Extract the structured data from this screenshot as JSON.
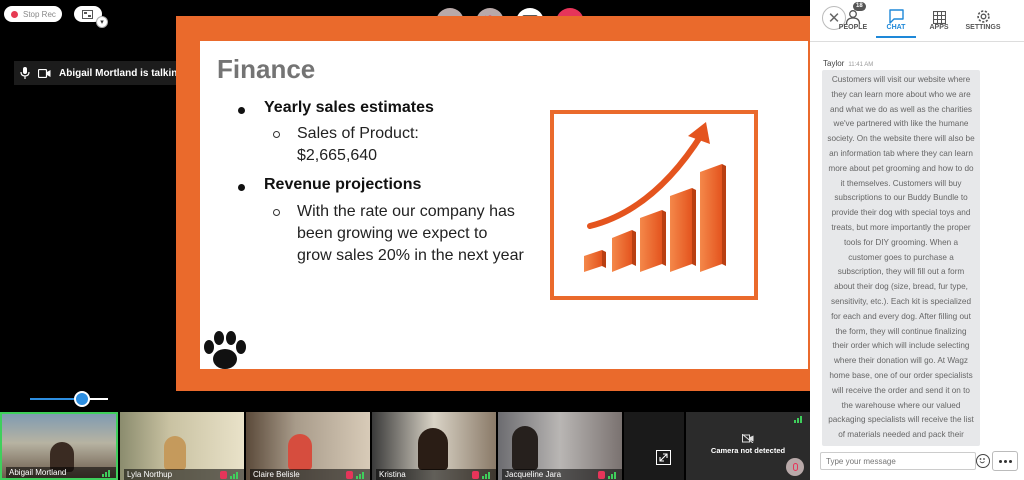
{
  "header": {
    "stop_rec_label": "Stop Rec",
    "talking_text": "Abigail Mortland is talking"
  },
  "slide": {
    "title": "Finance",
    "bullet1": "Yearly sales estimates",
    "sub1_line1": "Sales of Product:",
    "sub1_line2": "$2,665,640",
    "bullet2": "Revenue projections",
    "sub2_line1": "With the rate our company has",
    "sub2_line2": "been growing we expect to",
    "sub2_line3": "grow sales 20% in the next year"
  },
  "volume": {
    "level": 0.67
  },
  "filmstrip": {
    "participants": [
      {
        "name": "Abigail Mortland"
      },
      {
        "name": "Lyla Northup"
      },
      {
        "name": "Claire Belisle"
      },
      {
        "name": "Kristina"
      },
      {
        "name": "Jacqueline Jara"
      }
    ],
    "camera_status": "Camera not detected"
  },
  "panel": {
    "tabs": [
      {
        "label": "PEOPLE",
        "badge": "18"
      },
      {
        "label": "CHAT"
      },
      {
        "label": "APPS"
      },
      {
        "label": "SETTINGS"
      }
    ],
    "chat": {
      "author": "Taylor",
      "time": "11:41 AM",
      "message": "Customers will visit our website where they can learn more about who we are and what we do as well as the charities we've partnered with like the humane society. On the website there will also be an information tab where they can learn more about pet grooming and how to do it themselves. Customers will buy subscriptions to our Buddy Bundle to provide their dog with special toys and treats, but more importantly the proper tools for DIY grooming. When a customer goes to purchase a subscription, they will fill out a form about their dog (size, bread, fur type, sensitivity, etc.). Each kit is specialized for each and every dog. After filling out the form, they will continue finalizing their order which will include selecting where their donation will go. At Wagz home base, one of our order specialists will receive the order and send it on to the warehouse where our valued packaging specialists will receive the list of materials needed and pack their personalized Buddy Boxes. Each box will have an",
      "input_placeholder": "Type your message"
    }
  },
  "colors": {
    "accent": "#1e88d8",
    "slide_orange": "#ea6a2c",
    "end_call": "#e6355a"
  }
}
